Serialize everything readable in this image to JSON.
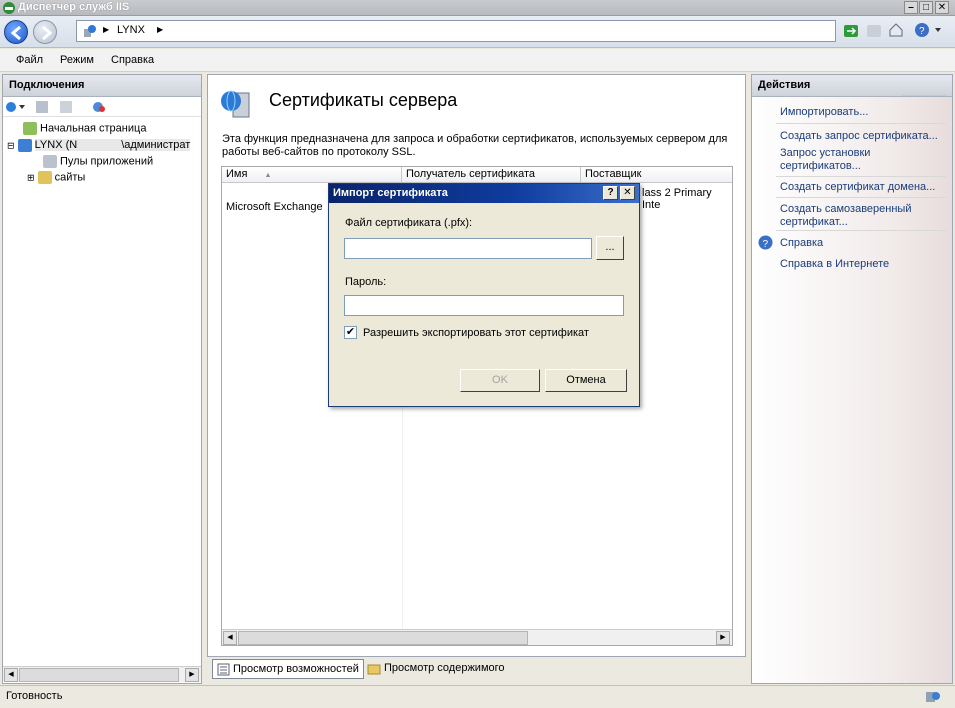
{
  "window": {
    "title": "Диспетчер служб IIS"
  },
  "address": {
    "crumb": "LYNX",
    "sep": "▶",
    "crumb_end": "▶"
  },
  "menu": {
    "items": [
      "Файл",
      "Режим",
      "Справка"
    ]
  },
  "connections": {
    "title": "Подключения",
    "tree": [
      {
        "label": "Начальная страница",
        "icon": "home-page-icon"
      },
      {
        "label": "LYNX (N        \\администрат",
        "icon": "server-icon"
      },
      {
        "label": "Пулы приложений",
        "icon": "app-pool-icon"
      },
      {
        "label": "сайты",
        "icon": "sites-folder-icon"
      }
    ]
  },
  "main": {
    "title": "Сертификаты сервера",
    "description": "Эта функция предназначена для запроса и обработки сертификатов, используемых сервером для работы веб-сайтов по протоколу SSL.",
    "columns": [
      "Имя",
      "Получатель сертификата",
      "Поставщик"
    ],
    "sort_arrow": "▲",
    "rows": [
      {
        "name": "Microsoft Exchange",
        "issuer": "lass 2 Primary Inte"
      }
    ]
  },
  "tabs": {
    "features": "Просмотр возможностей",
    "content": "Просмотр содержимого"
  },
  "actions": {
    "title": "Действия",
    "items": [
      "Импортировать...",
      "Создать запрос сертификата...",
      "Запрос установки сертификатов...",
      "Создать сертификат домена...",
      "Создать самозаверенный сертификат...",
      "Справка",
      "Справка в Интернете"
    ]
  },
  "dialog": {
    "title": "Импорт сертификата",
    "help_btn": "?",
    "close_btn": "✕",
    "file_label": "Файл сертификата (.pfx):",
    "file_value": "",
    "browse_label": "...",
    "password_label": "Пароль:",
    "password_value": "",
    "export_label": "Разрешить экспортировать этот сертификат",
    "export_checked": "✔",
    "ok_label": "OK",
    "cancel_label": "Отмена"
  },
  "status": {
    "text": "Готовность"
  },
  "colors": {
    "dialog_title": "#0a246a",
    "action_link": "#1a3c7a"
  }
}
